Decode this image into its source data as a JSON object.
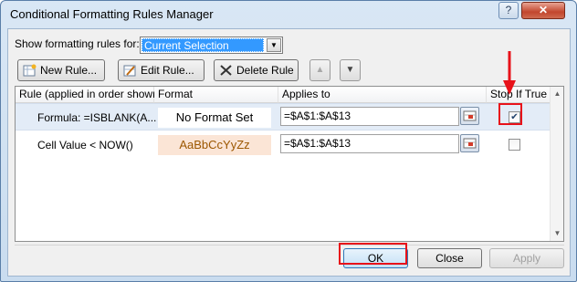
{
  "window": {
    "title": "Conditional Formatting Rules Manager",
    "help_label": "?",
    "close_label": "✕"
  },
  "scope": {
    "label": "Show formatting rules for:",
    "selected": "Current Selection"
  },
  "toolbar": {
    "new_rule": "New Rule...",
    "edit_rule": "Edit Rule...",
    "delete_rule": "Delete Rule",
    "move_up": "▲",
    "move_down": "▼"
  },
  "table": {
    "headers": [
      "Rule (applied in order shown)",
      "Format",
      "Applies to",
      "Stop If True"
    ],
    "rows": [
      {
        "rule": "Formula: =ISBLANK(A...",
        "format_preview": "No Format Set",
        "applies_to": "=$A$1:$A$13",
        "stop_if_true": true,
        "selected": true
      },
      {
        "rule": "Cell Value < NOW()",
        "format_preview": "AaBbCcYyZz",
        "applies_to": "=$A$1:$A$13",
        "stop_if_true": false,
        "selected": false
      }
    ]
  },
  "buttons": {
    "ok": "OK",
    "close": "Close",
    "apply": "Apply"
  },
  "colors": {
    "highlight_red": "#e8121a",
    "selected_row": "#e3ecf7",
    "format_fill": "#fbe5d6",
    "format_text": "#9c5700"
  }
}
